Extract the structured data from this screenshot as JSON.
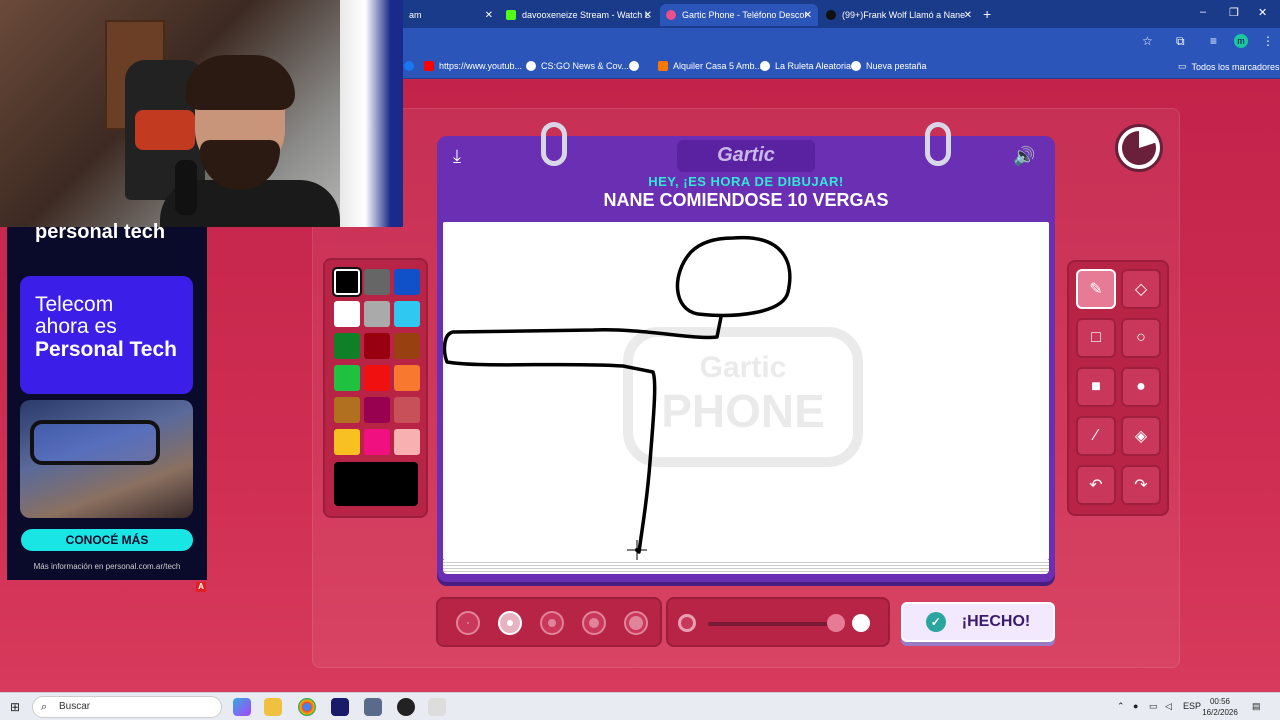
{
  "browser": {
    "tabs": [
      {
        "label": "am",
        "active": false
      },
      {
        "label": "davooxeneize Stream - Watch L",
        "active": false
      },
      {
        "label": "Gartic Phone - Teléfono Descor",
        "active": true
      },
      {
        "label": "(99+)Frank Wolf Llamó a Nane",
        "active": false
      }
    ],
    "new_tab": "+",
    "window_controls": [
      "–",
      "❐",
      "✕"
    ],
    "profile_initial": "m",
    "bookmarks": [
      {
        "label": "https://www.youtub...",
        "color": "#ff0000"
      },
      {
        "label": "CS:GO News & Cov...",
        "color": "#ffffff"
      },
      {
        "label": "",
        "color": "#ffffff"
      },
      {
        "label": "Alquiler Casa 5 Amb...",
        "color": "#ff7700"
      },
      {
        "label": "La Ruleta Aleatoria",
        "color": "#ffffff"
      },
      {
        "label": "Nueva pestaña",
        "color": "#ffffff"
      }
    ],
    "all_bookmarks": "Todos los marcadores"
  },
  "ad": {
    "brand": "personal tech",
    "line1": "Telecom",
    "line2": "ahora es",
    "line3": "Personal Tech",
    "cta": "CONOCÉ MÁS",
    "footer": "Más información en personal.com.ar/tech",
    "badge": "A"
  },
  "game": {
    "logo": "Gartic",
    "subtitle": "HEY, ¡ES HORA DE DIBUJAR!",
    "phrase": "NANE COMIENDOSE 10 VERGAS",
    "watermark_line1": "Gartic",
    "watermark_line2": "PHONE",
    "done_label": "¡HECHO!",
    "timer_fraction_remaining": 0.8,
    "selected_color": "#000000",
    "selected_size_index": 1,
    "opacity_value": 1.0
  },
  "palette": [
    "#000000",
    "#666666",
    "#1050c8",
    "#ffffff",
    "#aaaaaa",
    "#2ec8f0",
    "#108028",
    "#980010",
    "#984010",
    "#20c040",
    "#f01010",
    "#f87830",
    "#b07020",
    "#980050",
    "#c85058",
    "#f8c020",
    "#f01080",
    "#f8b0b0"
  ],
  "tools": [
    {
      "name": "pencil",
      "icon": "✎"
    },
    {
      "name": "eraser",
      "icon": "◇"
    },
    {
      "name": "rect-outline",
      "icon": "□"
    },
    {
      "name": "ellipse-outline",
      "icon": "○"
    },
    {
      "name": "rect-fill",
      "icon": "■"
    },
    {
      "name": "ellipse-fill",
      "icon": "●"
    },
    {
      "name": "line",
      "icon": "⁄"
    },
    {
      "name": "fill-bucket",
      "icon": "◈"
    },
    {
      "name": "undo",
      "icon": "↶"
    },
    {
      "name": "redo",
      "icon": "↷"
    }
  ],
  "taskbar": {
    "search": "Buscar",
    "language": "ESP",
    "time": "00:56",
    "date": "16/2/2026"
  }
}
